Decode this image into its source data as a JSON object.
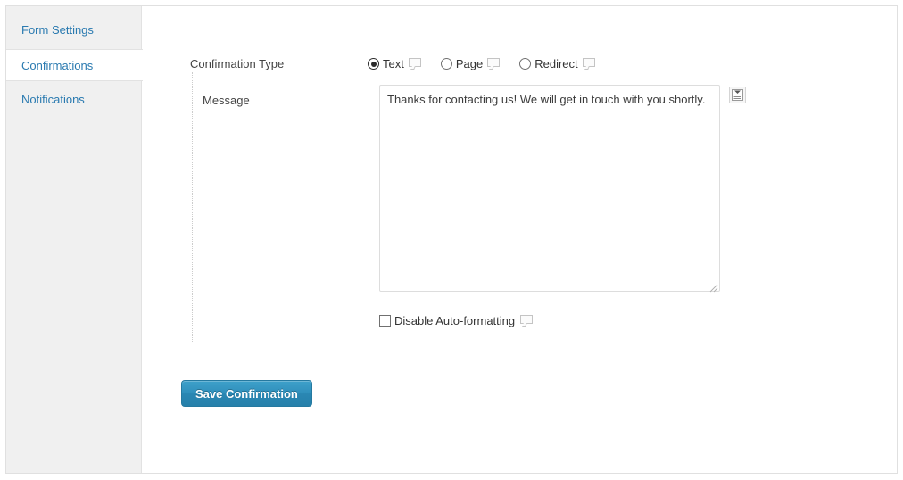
{
  "sidebar": {
    "tabs": [
      {
        "label": "Form Settings",
        "active": false
      },
      {
        "label": "Confirmations",
        "active": true
      },
      {
        "label": "Notifications",
        "active": false
      }
    ]
  },
  "main": {
    "confirmation_type": {
      "label": "Confirmation Type",
      "options": [
        {
          "label": "Text",
          "selected": true,
          "tooltip_icon": "tooltip-bubble-icon"
        },
        {
          "label": "Page",
          "selected": false,
          "tooltip_icon": "tooltip-bubble-icon"
        },
        {
          "label": "Redirect",
          "selected": false,
          "tooltip_icon": "tooltip-bubble-icon"
        }
      ]
    },
    "message": {
      "label": "Message",
      "value": "Thanks for contacting us! We will get in touch with you shortly.",
      "placeholder": "",
      "merge_tag_icon": "insert-merge-tag-icon",
      "resize_handle_icon": "resize-grip-icon"
    },
    "disable_autoformatting": {
      "label": "Disable Auto-formatting",
      "checked": false,
      "tooltip_icon": "tooltip-bubble-icon"
    },
    "save_button": {
      "label": "Save Confirmation"
    }
  },
  "colors": {
    "accent": "#2a7ab0",
    "button_top": "#3ea0ca",
    "button_bottom": "#2680aa",
    "sidebar_bg": "#f0f0f0",
    "border": "#e0e0e0"
  }
}
